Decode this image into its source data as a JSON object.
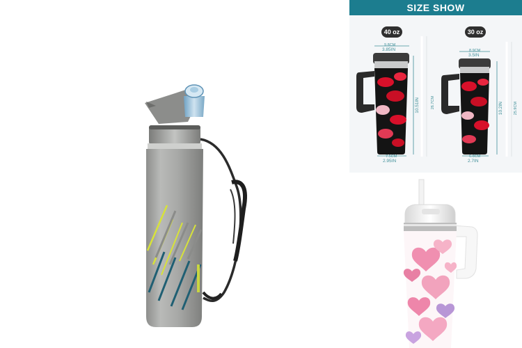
{
  "size_panel": {
    "banner": "SIZE SHOW",
    "tumbler_40oz": {
      "capacity": "40 oz",
      "top_width_small": "9.8CM",
      "top_width": "3.85IN",
      "bottom_width_small": "7.5CM",
      "bottom_width": "2.95IN",
      "height": "10.51IN",
      "height_small": "26.7CM"
    },
    "tumbler_30oz": {
      "capacity": "30 oz",
      "top_width_small": "8.9CM",
      "top_width": "3.5IN",
      "bottom_width_small": "6.8CM",
      "bottom_width": "2.7IN",
      "height": "10.2IN",
      "height_small": "25.9CM"
    }
  },
  "colors": {
    "banner": "#1c7d8f",
    "bottle_body": "#a9aaa8",
    "accent_lime": "#d7e23a",
    "accent_teal": "#1f5f73",
    "lips_red": "#d8102a",
    "hearts_pink": "#f2a3bd"
  }
}
